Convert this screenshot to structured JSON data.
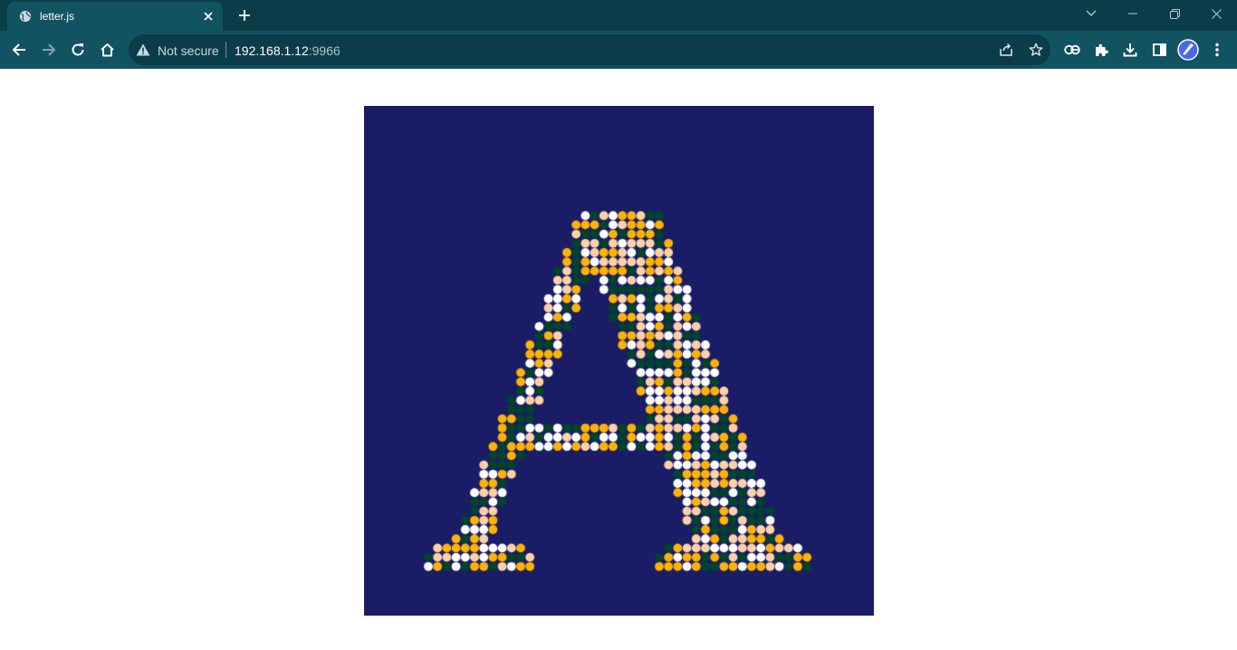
{
  "browser": {
    "tab": {
      "title": "letter.js"
    },
    "address": {
      "security_label": "Not secure",
      "host": "192.168.1.12",
      "port": ":9966"
    },
    "theme": {
      "tab_strip": "#0b3c49",
      "toolbar": "#125361",
      "omnibox": "#0b3c49"
    }
  },
  "sketch": {
    "letter": "A",
    "background": "#1a1c66",
    "palette": [
      "#ffffff",
      "#ffd1a6",
      "#ffb300",
      "#00442b"
    ]
  }
}
